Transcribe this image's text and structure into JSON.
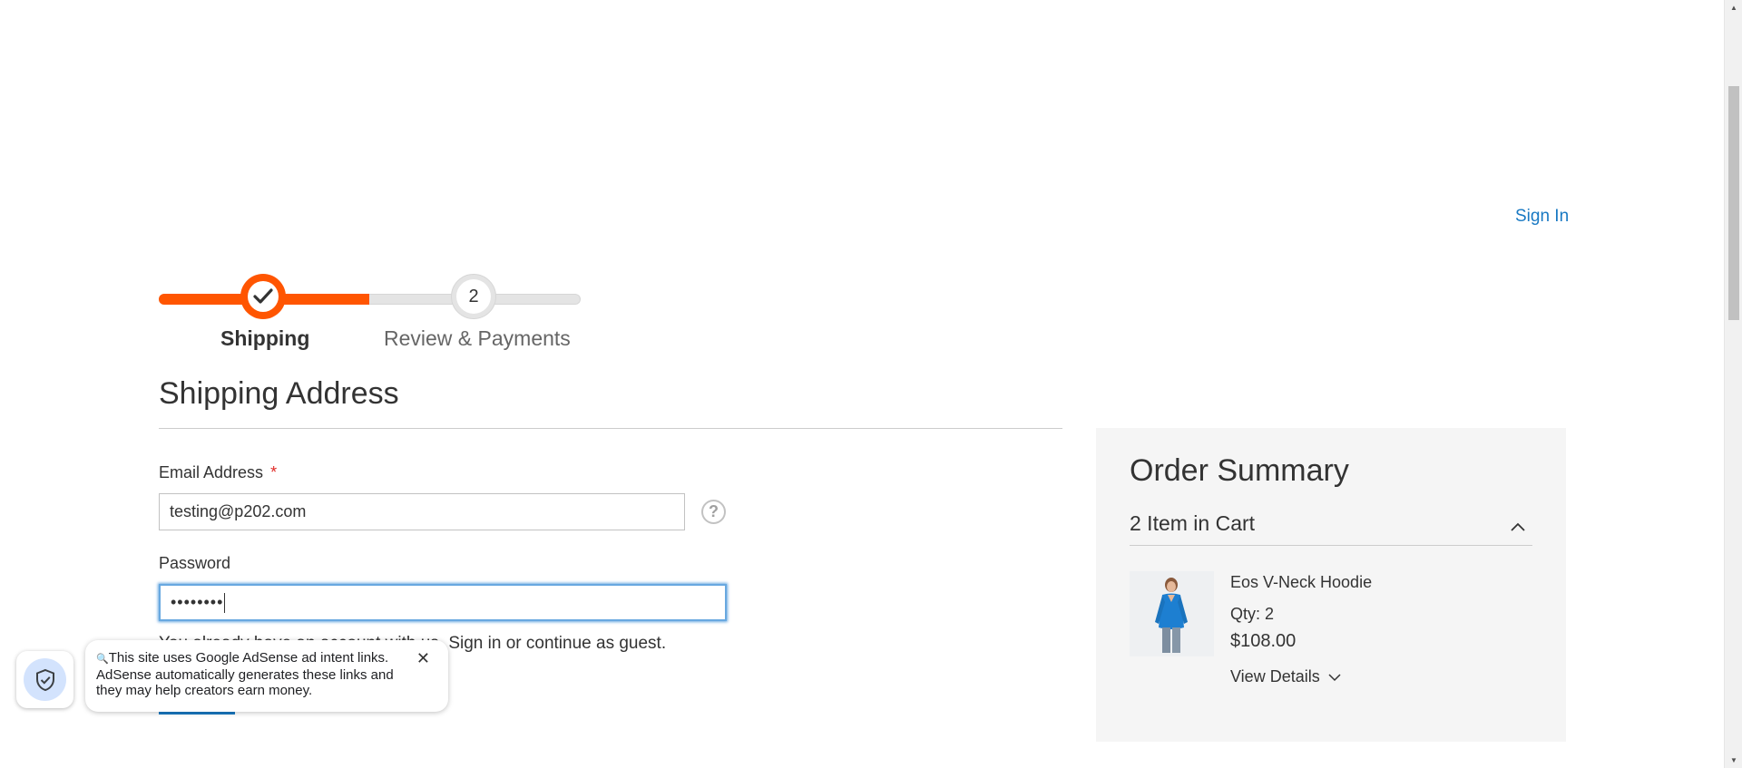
{
  "header": {
    "sign_in_label": "Sign In"
  },
  "progress": {
    "steps": [
      {
        "number": "1",
        "label": "Shipping",
        "status": "complete"
      },
      {
        "number": "2",
        "label": "Review & Payments",
        "status": "upcoming"
      }
    ],
    "accent_color": "#ff5501"
  },
  "shipping": {
    "title": "Shipping Address",
    "email": {
      "label": "Email Address",
      "required_mark": "*",
      "value": "testing@p202.com",
      "help_icon": "question-circle-icon"
    },
    "password": {
      "label": "Password",
      "masked_value": "••••••••"
    },
    "guest_note": "You already have an account with us. Sign in or continue as guest.",
    "guest_note_visible": "Sign in or continue as guest."
  },
  "summary": {
    "title": "Order Summary",
    "cart_count_label": "2 Item in Cart",
    "items": [
      {
        "name": "Eos V-Neck Hoodie",
        "qty_label": "Qty: 2",
        "price": "$108.00",
        "details_label": "View Details"
      }
    ]
  },
  "adsense_notice": {
    "icon": "shield-check-icon",
    "text": "This site uses Google AdSense ad intent links. AdSense automatically generates these links and they may help creators earn money."
  },
  "colors": {
    "link": "#1979c3",
    "required": "#e02b27",
    "summary_bg": "#f5f5f5"
  }
}
